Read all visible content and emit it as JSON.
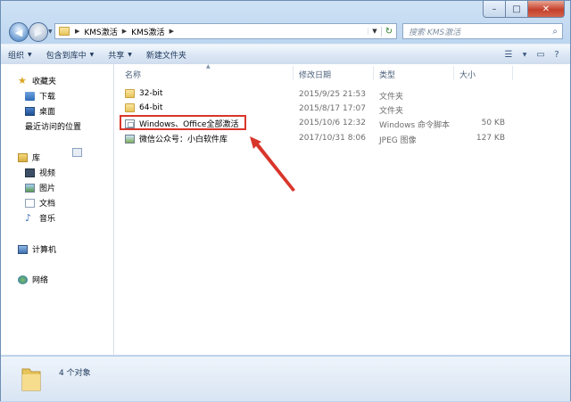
{
  "window": {
    "controls": {
      "minimize": "–",
      "maximize": "□",
      "close": "✕"
    }
  },
  "address": {
    "crumbs": [
      "KMS激活",
      "KMS激活"
    ],
    "search_placeholder": "搜索 KMS激活"
  },
  "toolbar": {
    "organize": "组织",
    "include_library": "包含到库中",
    "share": "共享",
    "new_folder": "新建文件夹"
  },
  "nav": {
    "favorites": "收藏夹",
    "downloads": "下载",
    "desktop": "桌面",
    "recent": "最近访问的位置",
    "libraries": "库",
    "videos": "视频",
    "pictures": "图片",
    "documents": "文档",
    "music": "音乐",
    "computer": "计算机",
    "network": "网络"
  },
  "columns": {
    "name": "名称",
    "date": "修改日期",
    "type": "类型",
    "size": "大小"
  },
  "files": [
    {
      "name": "32-bit",
      "date": "2015/9/25 21:53",
      "type": "文件夹",
      "size": "",
      "icon": "folder-icon"
    },
    {
      "name": "64-bit",
      "date": "2015/8/17 17:07",
      "type": "文件夹",
      "size": "",
      "icon": "folder-icon"
    },
    {
      "name": "Windows、Office全部激活",
      "date": "2015/10/6 12:32",
      "type": "Windows 命令脚本",
      "size": "50 KB",
      "icon": "cmd-script-icon"
    },
    {
      "name": "微信公众号：小白软件库",
      "date": "2017/10/31 8:06",
      "type": "JPEG 图像",
      "size": "127 KB",
      "icon": "jpeg-image-icon"
    }
  ],
  "status": {
    "count": "4 个对象"
  },
  "annotation": {
    "color": "#d9362b"
  }
}
